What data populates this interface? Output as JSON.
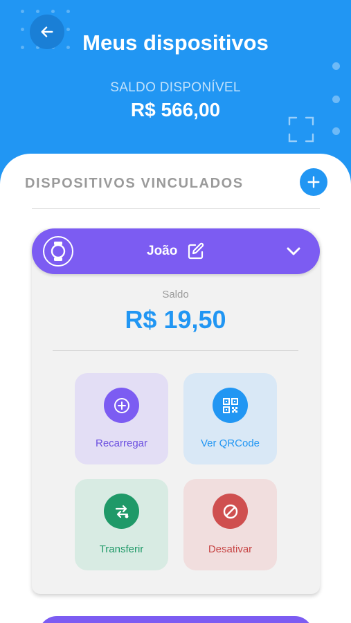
{
  "header": {
    "title": "Meus dispositivos",
    "balance_label": "SALDO DISPONÍVEL",
    "balance_value": "R$ 566,00",
    "back_icon": "arrow-left-icon",
    "scan_icon": "scan-frame-icon"
  },
  "section": {
    "title": "DISPOSITIVOS VINCULADOS",
    "add_icon": "plus-icon"
  },
  "device": {
    "name": "João",
    "icon": "watch-icon",
    "edit_icon": "edit-icon",
    "expand_icon": "chevron-down-icon",
    "saldo_label": "Saldo",
    "saldo_value": "R$ 19,50"
  },
  "actions": [
    {
      "label": "Recarregar",
      "icon": "plus-circle-icon",
      "color": "#7c5cf2"
    },
    {
      "label": "Ver QRCode",
      "icon": "qrcode-icon",
      "color": "#2196f3"
    },
    {
      "label": "Transferir",
      "icon": "transfer-icon",
      "color": "#1f9968"
    },
    {
      "label": "Desativar",
      "icon": "block-icon",
      "color": "#cf4f4f"
    }
  ],
  "colors": {
    "primary": "#2196f3",
    "accent_purple": "#7c5cf2"
  }
}
